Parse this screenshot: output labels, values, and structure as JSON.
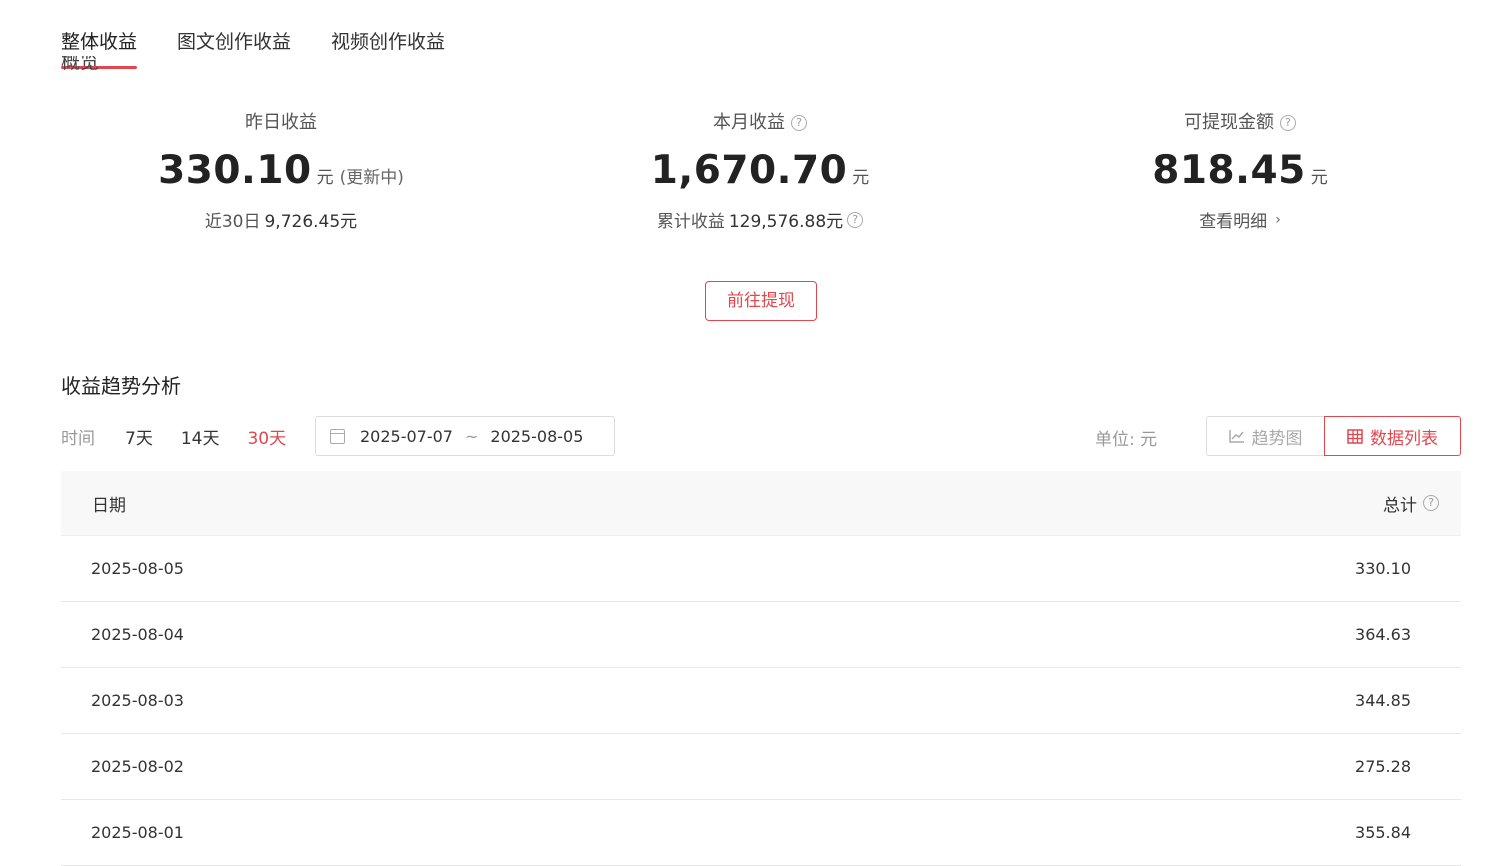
{
  "tabs": [
    {
      "label": "整体收益",
      "active": true
    },
    {
      "label": "图文创作收益",
      "active": false
    },
    {
      "label": "视频创作收益",
      "active": false
    }
  ],
  "overview_heading": "概览",
  "stats": {
    "yesterday": {
      "label": "昨日收益",
      "value": "330.10",
      "unit": "元",
      "note": "(更新中)",
      "sub_label": "近30日",
      "sub_value": "9,726.45元"
    },
    "month": {
      "label": "本月收益",
      "value": "1,670.70",
      "unit": "元",
      "sub_label": "累计收益",
      "sub_value": "129,576.88元"
    },
    "withdrawable": {
      "label": "可提现金额",
      "value": "818.45",
      "unit": "元",
      "link": "查看明细"
    }
  },
  "withdraw_button": "前往提现",
  "trend": {
    "title": "收益趋势分析",
    "time_label": "时间",
    "ranges": [
      {
        "label": "7天",
        "active": false
      },
      {
        "label": "14天",
        "active": false
      },
      {
        "label": "30天",
        "active": true
      }
    ],
    "date_start": "2025-07-07",
    "date_sep": "~",
    "date_end": "2025-08-05",
    "unit_text": "单位: 元",
    "view_trend": "趋势图",
    "view_list": "数据列表"
  },
  "table": {
    "col_date": "日期",
    "col_total": "总计",
    "rows": [
      {
        "date": "2025-08-05",
        "total": "330.10"
      },
      {
        "date": "2025-08-04",
        "total": "364.63"
      },
      {
        "date": "2025-08-03",
        "total": "344.85"
      },
      {
        "date": "2025-08-02",
        "total": "275.28"
      },
      {
        "date": "2025-08-01",
        "total": "355.84"
      }
    ]
  },
  "colors": {
    "accent": "#e0474f"
  }
}
